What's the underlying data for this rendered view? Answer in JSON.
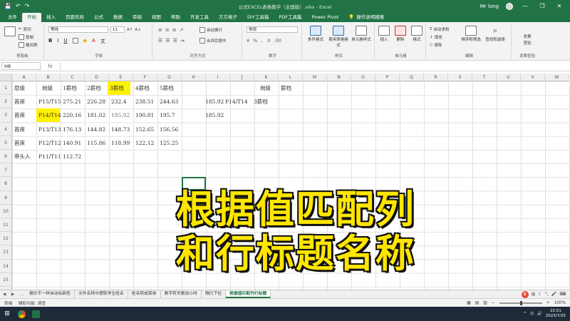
{
  "titlebar": {
    "doc_title": "公式EXCEL表格教学（全国版）.xlsx - Excel",
    "user": "Mr long",
    "qa_save": "💾",
    "qa_undo": "↶",
    "qa_redo": "↷",
    "minimize": "—",
    "restore": "❐",
    "close": "✕"
  },
  "tabs": [
    "文件",
    "开始",
    "插入",
    "页面布局",
    "公式",
    "数据",
    "审阅",
    "视图",
    "帮助",
    "开发工具",
    "方方格子",
    "DIY工具箱",
    "PDF工具集",
    "Power Pivot"
  ],
  "tabs_active_index": 1,
  "help_search": "操作说明搜索",
  "ribbon": {
    "clipboard": {
      "cut": "剪切",
      "copy": "复制",
      "paint": "格式刷",
      "label": "剪贴板"
    },
    "font": {
      "name": "等线",
      "size": "11",
      "label": "字体",
      "bold": "B",
      "italic": "I",
      "underline": "U"
    },
    "align": {
      "wrap": "自动换行",
      "merge": "合并后居中",
      "label": "对齐方式"
    },
    "number": {
      "format": "常规",
      "label": "数字"
    },
    "styles": {
      "cond": "条件格式",
      "table": "套用表格格式",
      "cell": "单元格样式",
      "label": "样式"
    },
    "cells": {
      "insert": "插入",
      "delete": "删除",
      "format": "格式",
      "label": "单元格"
    },
    "editing": {
      "autosum": "自动求和",
      "fill": "填充",
      "clear": "清除",
      "sort": "排序和筛选",
      "find": "查找和选择",
      "label": "编辑"
    },
    "send": {
      "line1": "发票",
      "line2": "查验",
      "label": "发票查验"
    }
  },
  "formula_bar": {
    "name_box": "H8",
    "fx": "fx",
    "value": ""
  },
  "columns": [
    "A",
    "B",
    "C",
    "D",
    "E",
    "F",
    "G",
    "H",
    "I",
    "J",
    "K",
    "L",
    "M",
    "N",
    "O",
    "P",
    "Q",
    "R",
    "S",
    "T",
    "U",
    "V",
    "W"
  ],
  "rows": [
    "1",
    "2",
    "3",
    "4",
    "5",
    "6",
    "7",
    "8",
    "9",
    "10",
    "11",
    "12",
    "13",
    "14",
    "15",
    "16"
  ],
  "table": {
    "header": [
      "层级",
      "岗级",
      "1薪档",
      "2薪档",
      "3薪档",
      "4薪档",
      "5薪档"
    ],
    "rows": [
      [
        "首席",
        "P15/T15",
        "275.21",
        "226.28",
        "232.4",
        "238.51",
        "244.63"
      ],
      [
        "首席",
        "P14/T14",
        "220.16",
        "181.02",
        "185.92",
        "190.81",
        "195.7"
      ],
      [
        "首席",
        "P13/T13",
        "176.13",
        "144.82",
        "148.73",
        "152.65",
        "156.56"
      ],
      [
        "首席",
        "P12/T12",
        "140.91",
        "115.86",
        "118.99",
        "122.12",
        "125.25"
      ],
      [
        "带头人",
        "P11/T11",
        "112.72",
        "",
        "",
        "",
        ""
      ]
    ]
  },
  "lookup": {
    "header": [
      "",
      "岗级",
      "薪档"
    ],
    "row2": [
      "185.92",
      "P14/T14",
      "3薪档"
    ],
    "row3": [
      "185.92",
      "",
      ""
    ]
  },
  "overlay": {
    "line1": "根据值匹配列",
    "line2": "和行标题名称"
  },
  "sheets": [
    "报价不一样自动标颜色",
    "文件名称中提取学生姓名",
    "姓名转成菜单",
    "数字转天数加小时",
    "隔行下拉",
    "根据值匹配列行标题"
  ],
  "sheets_active_index": 5,
  "status": {
    "ready": "就绪",
    "accessibility": "辅助功能: 调查",
    "zoom": "100%"
  },
  "ime": {
    "logo": "S",
    "lang": "中"
  },
  "taskbar": {
    "time": "22:51",
    "date": "2023/7/25"
  }
}
